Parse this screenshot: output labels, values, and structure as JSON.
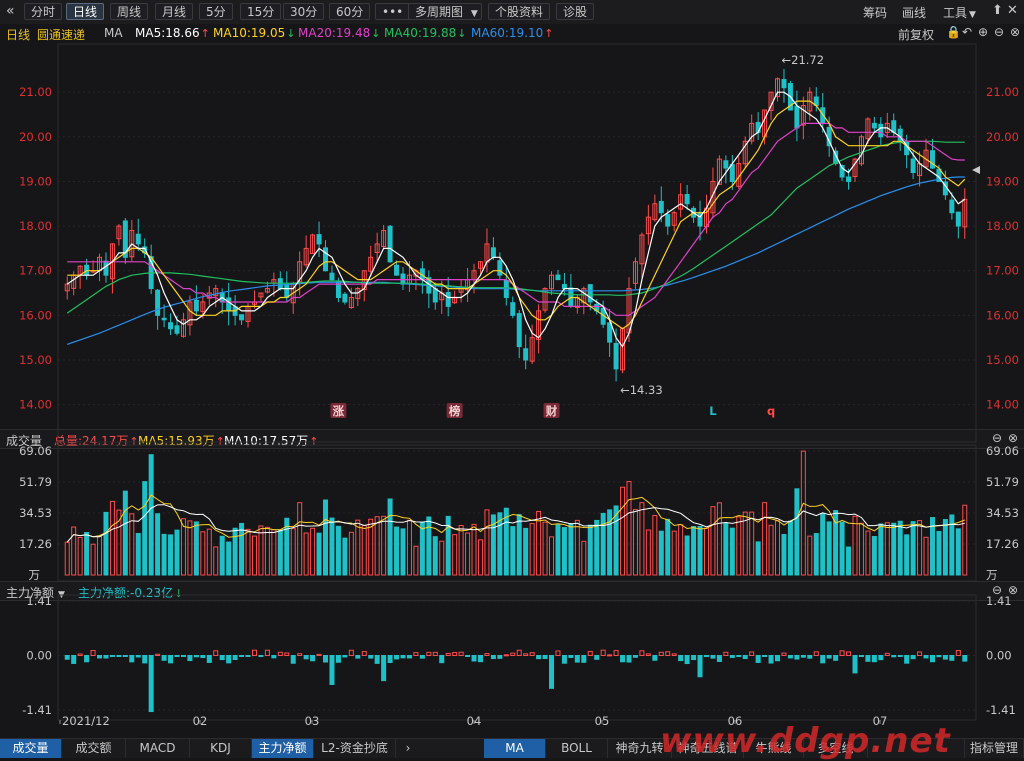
{
  "toolbar": {
    "back_icon": "double-chevron-left-icon",
    "buttons": [
      "分时",
      "日线",
      "周线",
      "月线",
      "5分",
      "15分",
      "30分",
      "60分",
      "•••",
      "多周期图",
      "个股资料",
      "诊股"
    ],
    "dropdown_icon": "caret-down-icon",
    "right": {
      "chips": "筹码",
      "draw": "画线",
      "tools": "工具"
    },
    "win_icons": [
      "restore-icon",
      "minimize-icon",
      "close-icon"
    ]
  },
  "ma_header": {
    "period": "日线",
    "name": "圆通速递",
    "ind": "MA",
    "ma5": "MA5:18.66",
    "ma10": "MA10:19.05",
    "ma20": "MA20:19.48",
    "ma40": "MA40:19.88",
    "ma60": "MA60:19.10",
    "adjust": "前复权",
    "icons": [
      "lock-icon",
      "undo-icon",
      "zoom-in-icon",
      "zoom-out-icon",
      "close-icon"
    ]
  },
  "volume_header": {
    "title": "成交量",
    "total": "总量:24.17万",
    "ma5": "MA5:15.93万",
    "ma10": "MA10:17.57万"
  },
  "flow_header": {
    "title": "主力净额",
    "value": "主力净额:-0.23亿"
  },
  "colors": {
    "up": "#ff4b4b",
    "down": "#20c0c8",
    "ma5": "#ffffff",
    "ma10": "#ffd21e",
    "ma20": "#e040c8",
    "ma40": "#20c060",
    "ma60": "#2890f0",
    "axis_price": "#e03030"
  },
  "bottom_tabs": {
    "left": [
      "成交量",
      "成交额",
      "MACD",
      "KDJ",
      "主力净额",
      "L2-资金抄底"
    ],
    "right": [
      "MA",
      "BOLL",
      "神奇九转",
      "神奇五线谱",
      "牛熊线",
      "多空线"
    ],
    "manage": "指标管理",
    "more_icon": "chevron-right-icon"
  },
  "watermark": "www.ddgp.net",
  "chart_data": [
    {
      "type": "candlestick",
      "title": "",
      "y_ticks": [
        "21.00",
        "20.00",
        "19.00",
        "18.00",
        "17.00",
        "16.00",
        "15.00",
        "14.00"
      ],
      "ylim": [
        13.7,
        21.9
      ],
      "annotations": [
        {
          "text": "←21.72",
          "value": 21.72
        },
        {
          "text": "←14.33",
          "value": 14.33
        }
      ],
      "markers": [
        "涨",
        "榜",
        "财",
        "L",
        "q"
      ],
      "series_close": [
        16.7,
        16.9,
        17.1,
        16.9,
        17.0,
        17.3,
        16.9,
        17.6,
        18.0,
        17.3,
        17.9,
        17.6,
        17.4,
        16.6,
        16.0,
        15.9,
        15.7,
        15.6,
        15.9,
        16.3,
        16.1,
        16.3,
        16.5,
        16.6,
        16.3,
        16.1,
        16.0,
        15.9,
        16.2,
        16.3,
        16.5,
        16.6,
        16.8,
        16.6,
        16.4,
        16.7,
        17.2,
        17.5,
        17.8,
        17.6,
        17.0,
        16.8,
        16.4,
        16.3,
        16.4,
        16.6,
        17.0,
        17.3,
        17.6,
        17.9,
        17.2,
        16.9,
        16.7,
        16.9,
        17.0,
        16.8,
        16.5,
        16.3,
        16.5,
        16.2,
        16.4,
        16.6,
        16.8,
        17.0,
        17.2,
        17.6,
        17.3,
        16.9,
        16.4,
        16.0,
        15.3,
        15.0,
        15.5,
        16.1,
        16.6,
        16.9,
        16.8,
        16.6,
        16.2,
        16.4,
        16.6,
        16.3,
        16.1,
        15.8,
        15.4,
        14.8,
        15.7,
        16.6,
        17.2,
        17.8,
        18.2,
        18.5,
        18.3,
        18.0,
        18.3,
        18.7,
        18.5,
        18.2,
        18.0,
        18.4,
        19.0,
        19.5,
        19.3,
        19.0,
        19.4,
        19.9,
        20.3,
        20.1,
        20.6,
        21.0,
        21.3,
        21.1,
        20.6,
        20.2,
        20.7,
        21.0,
        20.7,
        20.3,
        19.8,
        19.4,
        19.1,
        19.0,
        19.5,
        20.0,
        20.4,
        20.2,
        20.0,
        20.3,
        20.1,
        19.9,
        19.6,
        19.2,
        19.4,
        19.7,
        19.3,
        19.0,
        18.7,
        18.3,
        18.0,
        18.6
      ],
      "ma5": [
        16.7,
        16.8,
        16.9,
        16.9,
        16.9,
        17.0,
        17.1,
        17.2,
        17.4,
        17.4,
        17.6,
        17.5,
        17.5,
        17.2,
        16.9,
        16.5,
        16.2,
        15.9,
        15.8,
        15.9,
        15.9,
        16.0,
        16.2,
        16.3,
        16.4,
        16.3,
        16.2,
        16.1,
        16.1,
        16.1,
        16.2,
        16.4,
        16.5,
        16.6,
        16.6,
        16.6,
        16.8,
        17.0,
        17.3,
        17.5,
        17.4,
        17.3,
        17.0,
        16.7,
        16.5,
        16.5,
        16.6,
        16.9,
        17.2,
        17.5,
        17.5,
        17.4,
        17.3,
        17.1,
        16.9,
        16.8,
        16.7,
        16.6,
        16.5,
        16.4,
        16.4,
        16.4,
        16.5,
        16.7,
        16.9,
        17.2,
        17.3,
        17.3,
        17.1,
        16.8,
        16.4,
        15.9,
        15.6,
        15.5,
        15.7,
        16.0,
        16.4,
        16.6,
        16.6,
        16.6,
        16.5,
        16.4,
        16.3,
        16.2,
        15.9,
        15.5,
        15.3,
        15.6,
        16.1,
        16.8,
        17.4,
        18.0,
        18.2,
        18.3,
        18.4,
        18.5,
        18.4,
        18.3,
        18.2,
        18.4,
        18.7,
        19.0,
        19.2,
        19.4,
        19.6,
        19.8,
        20.0,
        20.1,
        20.4,
        20.7,
        21.0,
        21.0,
        20.9,
        20.7,
        20.6,
        20.5,
        20.4,
        20.2,
        19.9,
        19.6,
        19.3,
        19.2,
        19.4,
        19.6,
        19.9,
        20.1,
        20.2,
        20.2,
        20.1,
        20.0,
        19.8,
        19.6,
        19.4,
        19.3,
        19.2,
        19.1,
        18.9,
        18.7,
        18.5,
        18.6
      ],
      "ma10": [
        16.9,
        16.9,
        16.9,
        17.0,
        17.0,
        17.0,
        17.1,
        17.2,
        17.3,
        17.4,
        17.5,
        17.5,
        17.4,
        17.3,
        17.1,
        16.9,
        16.7,
        16.5,
        16.3,
        16.1,
        16.0,
        16.0,
        16.0,
        16.0,
        16.1,
        16.1,
        16.1,
        16.2,
        16.2,
        16.2,
        16.2,
        16.3,
        16.3,
        16.4,
        16.4,
        16.5,
        16.6,
        16.7,
        16.9,
        17.1,
        17.2,
        17.2,
        17.1,
        17.0,
        16.9,
        16.8,
        16.8,
        16.8,
        16.9,
        17.0,
        17.1,
        17.2,
        17.2,
        17.1,
        17.0,
        16.9,
        16.8,
        16.7,
        16.7,
        16.6,
        16.6,
        16.6,
        16.6,
        16.7,
        16.8,
        16.9,
        17.0,
        17.0,
        16.9,
        16.7,
        16.4,
        16.2,
        16.0,
        15.9,
        15.9,
        16.0,
        16.2,
        16.3,
        16.4,
        16.4,
        16.3,
        16.2,
        16.1,
        16.0,
        15.9,
        15.8,
        15.7,
        15.8,
        16.0,
        16.3,
        16.6,
        16.9,
        17.2,
        17.5,
        17.8,
        18.1,
        18.2,
        18.3,
        18.3,
        18.3,
        18.5,
        18.7,
        18.8,
        18.9,
        19.1,
        19.3,
        19.5,
        19.7,
        20.0,
        20.3,
        20.5,
        20.6,
        20.7,
        20.8,
        20.8,
        20.8,
        20.7,
        20.5,
        20.3,
        20.0,
        19.9,
        19.8,
        19.8,
        19.8,
        19.8,
        19.8,
        19.8,
        19.8,
        19.9,
        19.9,
        19.8,
        19.7,
        19.6,
        19.5,
        19.4,
        19.3,
        19.1,
        19.0,
        18.9,
        19.05
      ],
      "ma20": [
        17.2,
        17.2,
        17.2,
        17.2,
        17.2,
        17.2,
        17.2,
        17.2,
        17.2,
        17.2,
        17.2,
        17.2,
        17.2,
        17.1,
        17.0,
        16.9,
        16.8,
        16.7,
        16.6,
        16.6,
        16.5,
        16.5,
        16.4,
        16.4,
        16.3,
        16.3,
        16.3,
        16.3,
        16.3,
        16.3,
        16.3,
        16.3,
        16.3,
        16.3,
        16.3,
        16.4,
        16.4,
        16.5,
        16.6,
        16.7,
        16.7,
        16.7,
        16.7,
        16.7,
        16.7,
        16.7,
        16.7,
        16.7,
        16.8,
        16.8,
        16.8,
        16.8,
        16.8,
        16.8,
        16.8,
        16.8,
        16.8,
        16.8,
        16.8,
        16.8,
        16.8,
        16.8,
        16.8,
        16.8,
        16.8,
        16.8,
        16.8,
        16.8,
        16.8,
        16.7,
        16.6,
        16.5,
        16.4,
        16.3,
        16.3,
        16.3,
        16.3,
        16.2,
        16.2,
        16.2,
        16.2,
        16.2,
        16.2,
        16.2,
        16.1,
        16.0,
        16.0,
        16.0,
        16.1,
        16.2,
        16.3,
        16.4,
        16.6,
        16.8,
        17.0,
        17.2,
        17.4,
        17.6,
        17.8,
        18.0,
        18.2,
        18.3,
        18.5,
        18.6,
        18.8,
        19.0,
        19.2,
        19.3,
        19.5,
        19.7,
        19.9,
        20.0,
        20.1,
        20.2,
        20.3,
        20.3,
        20.3,
        20.3,
        20.3,
        20.2,
        20.2,
        20.1,
        20.1,
        20.1,
        20.1,
        20.1,
        20.1,
        20.0,
        20.0,
        20.0,
        19.9,
        19.9,
        19.9,
        19.9,
        19.8,
        19.7,
        19.6,
        19.5,
        19.48,
        19.48
      ],
      "ma40": [
        16.05,
        16.15,
        16.25,
        16.35,
        16.45,
        16.55,
        16.65,
        16.72,
        16.8,
        16.85,
        16.9,
        16.92,
        16.94,
        16.95,
        16.95,
        16.95,
        16.95,
        16.94,
        16.93,
        16.92,
        16.9,
        16.88,
        16.86,
        16.84,
        16.82,
        16.8,
        16.78,
        16.76,
        16.75,
        16.74,
        16.73,
        16.72,
        16.72,
        16.72,
        16.72,
        16.72,
        16.73,
        16.74,
        16.75,
        16.76,
        16.77,
        16.77,
        16.77,
        16.76,
        16.75,
        16.74,
        16.73,
        16.72,
        16.72,
        16.72,
        16.72,
        16.72,
        16.72,
        16.72,
        16.71,
        16.7,
        16.69,
        16.68,
        16.67,
        16.66,
        16.65,
        16.64,
        16.63,
        16.62,
        16.62,
        16.62,
        16.62,
        16.62,
        16.62,
        16.61,
        16.6,
        16.58,
        16.56,
        16.54,
        16.52,
        16.5,
        16.49,
        16.48,
        16.47,
        16.46,
        16.46,
        16.46,
        16.46,
        16.46,
        16.46,
        16.45,
        16.45,
        16.46,
        16.48,
        16.5,
        16.55,
        16.6,
        16.66,
        16.72,
        16.8,
        16.88,
        16.96,
        17.05,
        17.15,
        17.25,
        17.35,
        17.45,
        17.55,
        17.65,
        17.75,
        17.85,
        17.95,
        18.05,
        18.15,
        18.25,
        18.4,
        18.55,
        18.7,
        18.85,
        18.95,
        19.05,
        19.15,
        19.25,
        19.35,
        19.42,
        19.48,
        19.55,
        19.6,
        19.65,
        19.7,
        19.75,
        19.8,
        19.83,
        19.86,
        19.88,
        19.9,
        19.9,
        19.9,
        19.9,
        19.9,
        19.89,
        19.88,
        19.88,
        19.88,
        19.88
      ],
      "ma60": [
        15.35,
        15.4,
        15.45,
        15.5,
        15.55,
        15.6,
        15.66,
        15.72,
        15.78,
        15.84,
        15.9,
        15.96,
        16.02,
        16.08,
        16.13,
        16.18,
        16.22,
        16.26,
        16.3,
        16.34,
        16.38,
        16.42,
        16.45,
        16.48,
        16.51,
        16.54,
        16.56,
        16.58,
        16.6,
        16.62,
        16.64,
        16.66,
        16.67,
        16.68,
        16.69,
        16.7,
        16.71,
        16.72,
        16.73,
        16.74,
        16.74,
        16.74,
        16.74,
        16.74,
        16.74,
        16.74,
        16.74,
        16.74,
        16.74,
        16.74,
        16.73,
        16.72,
        16.71,
        16.7,
        16.69,
        16.68,
        16.67,
        16.66,
        16.65,
        16.64,
        16.63,
        16.62,
        16.61,
        16.6,
        16.6,
        16.6,
        16.6,
        16.6,
        16.6,
        16.59,
        16.58,
        16.57,
        16.56,
        16.55,
        16.55,
        16.55,
        16.55,
        16.55,
        16.55,
        16.55,
        16.55,
        16.55,
        16.55,
        16.55,
        16.55,
        16.55,
        16.55,
        16.56,
        16.57,
        16.58,
        16.6,
        16.62,
        16.65,
        16.68,
        16.72,
        16.76,
        16.8,
        16.85,
        16.9,
        16.95,
        17.0,
        17.05,
        17.1,
        17.16,
        17.22,
        17.28,
        17.34,
        17.4,
        17.47,
        17.54,
        17.61,
        17.68,
        17.75,
        17.82,
        17.89,
        17.96,
        18.03,
        18.1,
        18.17,
        18.24,
        18.31,
        18.38,
        18.44,
        18.5,
        18.56,
        18.62,
        18.68,
        18.73,
        18.78,
        18.83,
        18.88,
        18.92,
        18.96,
        18.99,
        19.02,
        19.05,
        19.07,
        19.09,
        19.1,
        19.1
      ]
    },
    {
      "type": "bar",
      "title": "",
      "y_ticks": [
        "69.06",
        "51.79",
        "34.53",
        "17.26"
      ],
      "unit": "万",
      "ylim": [
        0,
        69.06
      ]
    },
    {
      "type": "bar",
      "title": "",
      "y_ticks": [
        "1.41",
        "0.00",
        "-1.41"
      ],
      "ylim": [
        -1.41,
        1.41
      ]
    }
  ],
  "x_axis": [
    "2021/12",
    "02",
    "03",
    "04",
    "05",
    "06",
    "07"
  ]
}
